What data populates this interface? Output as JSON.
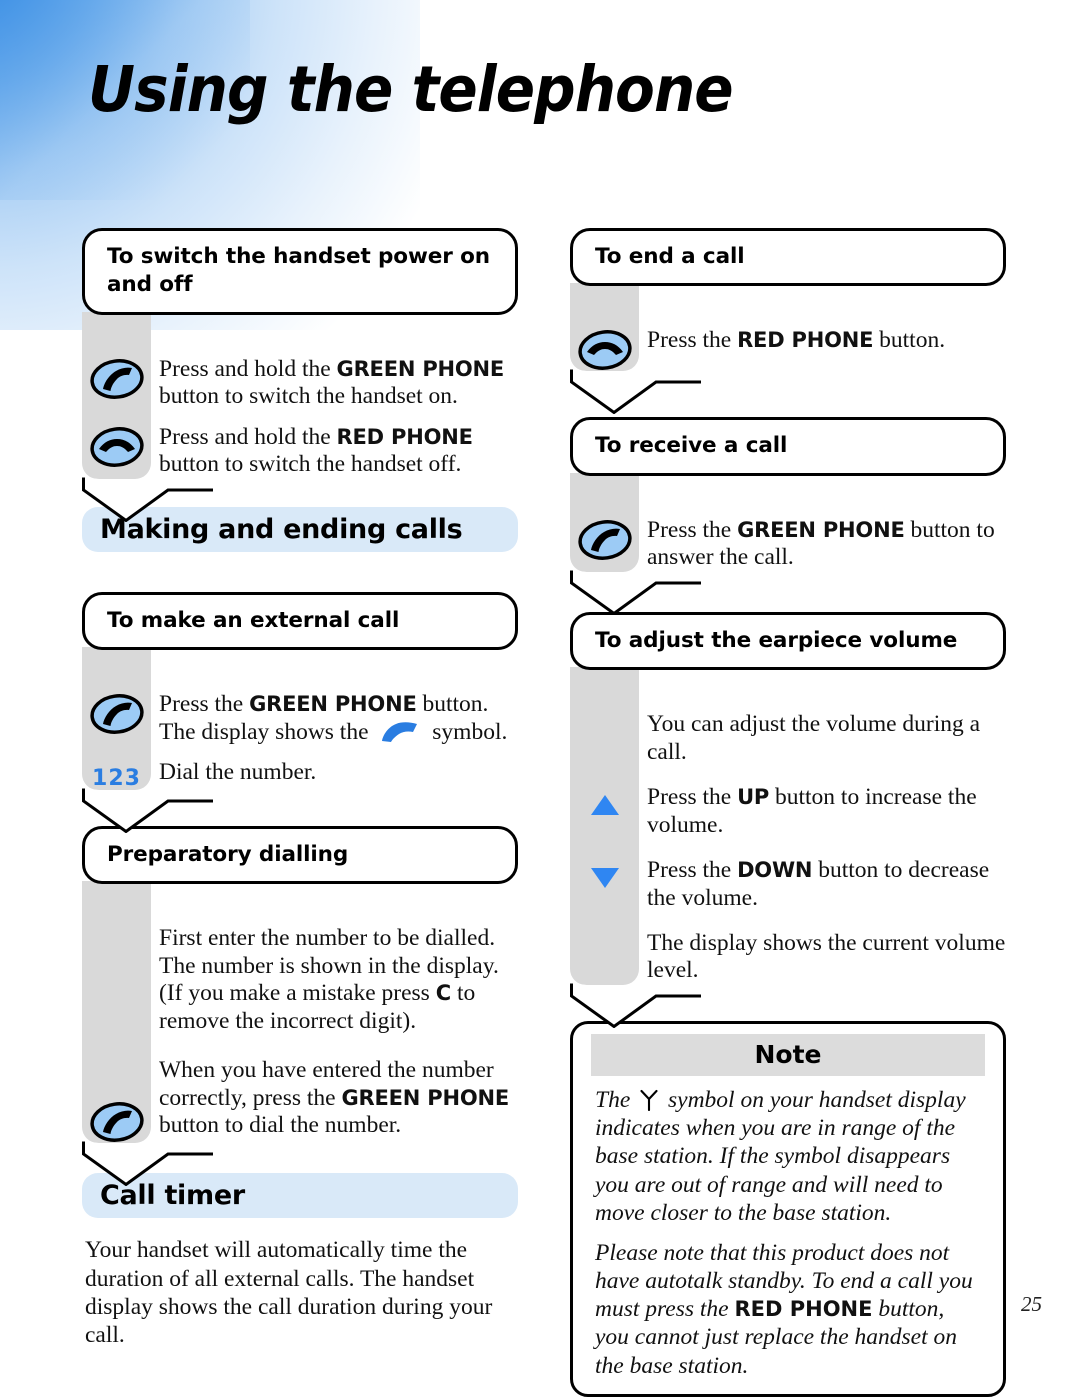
{
  "page": {
    "title": "Using the telephone",
    "number": "25"
  },
  "left_column": {
    "power_block": {
      "title": "To switch the handset power on and off",
      "rows": [
        {
          "icon": "green-phone-icon",
          "segments": [
            {
              "t": "Press and hold the ",
              "b": false
            },
            {
              "t": "GREEN PHONE",
              "b": true
            },
            {
              "t": " button to switch the handset on.",
              "b": false
            }
          ]
        },
        {
          "icon": "red-phone-icon",
          "segments": [
            {
              "t": "Press and hold the ",
              "b": false
            },
            {
              "t": "RED PHONE",
              "b": true
            },
            {
              "t": " button to switch the handset off.",
              "b": false
            }
          ]
        }
      ]
    },
    "making_ending_heading": "Making and ending calls",
    "external_call_block": {
      "title": "To make an external call",
      "rows": [
        {
          "icon": "green-phone-icon",
          "segments": [
            {
              "t": "Press the ",
              "b": false
            },
            {
              "t": "GREEN PHONE",
              "b": true
            },
            {
              "t": " button. The display shows the ",
              "b": false
            },
            {
              "t": "",
              "b": false,
              "glyph": "blue-handset-icon"
            },
            {
              "t": " symbol.",
              "b": false
            }
          ]
        },
        {
          "icon": "digits-123-icon",
          "icon_label": "123",
          "segments": [
            {
              "t": "Dial the number.",
              "b": false
            }
          ]
        }
      ]
    },
    "preparatory_block": {
      "title": "Preparatory dialling",
      "rows": [
        {
          "icon": "none",
          "segments": [
            {
              "t": "First enter the number to be dialled. The number is shown in the display. (If you make a mistake press ",
              "b": false
            },
            {
              "t": "C",
              "b": true
            },
            {
              "t": " to remove the incorrect digit).",
              "b": false
            }
          ]
        },
        {
          "icon": "green-phone-icon",
          "segments": [
            {
              "t": "When you have entered the number correctly, press the ",
              "b": false
            },
            {
              "t": "GREEN PHONE",
              "b": true
            },
            {
              "t": " button to dial the number.",
              "b": false
            }
          ]
        }
      ]
    },
    "call_timer_heading": "Call timer",
    "call_timer_text": "Your handset will automatically time the duration of all external calls. The handset display shows the call duration during your call."
  },
  "right_column": {
    "end_call_block": {
      "title": "To end a call",
      "rows": [
        {
          "icon": "red-phone-icon",
          "segments": [
            {
              "t": "Press the ",
              "b": false
            },
            {
              "t": "RED PHONE",
              "b": true
            },
            {
              "t": " button.",
              "b": false
            }
          ]
        }
      ]
    },
    "receive_call_block": {
      "title": "To receive a call",
      "rows": [
        {
          "icon": "green-phone-icon",
          "segments": [
            {
              "t": "Press the ",
              "b": false
            },
            {
              "t": "GREEN PHONE",
              "b": true
            },
            {
              "t": " button to answer the call.",
              "b": false
            }
          ]
        }
      ]
    },
    "volume_block": {
      "title": "To adjust the earpiece volume",
      "rows": [
        {
          "icon": "none",
          "segments": [
            {
              "t": "You can adjust the volume during a call.",
              "b": false
            }
          ]
        },
        {
          "icon": "up-triangle-icon",
          "segments": [
            {
              "t": "Press the ",
              "b": false
            },
            {
              "t": "UP",
              "b": true
            },
            {
              "t": " button to increase the volume.",
              "b": false
            }
          ]
        },
        {
          "icon": "down-triangle-icon",
          "segments": [
            {
              "t": "Press the ",
              "b": false
            },
            {
              "t": "DOWN",
              "b": true
            },
            {
              "t": " button to decrease the volume.",
              "b": false
            }
          ]
        },
        {
          "icon": "none",
          "segments": [
            {
              "t": "The display shows the current volume level.",
              "b": false
            }
          ]
        }
      ]
    },
    "note": {
      "heading": "Note",
      "paragraphs": [
        [
          {
            "t": "The ",
            "b": false
          },
          {
            "t": "",
            "b": false,
            "glyph": "antenna-icon"
          },
          {
            "t": " symbol on your handset display indicates when you are in range of the base station. If the symbol disappears you are out of range and will need to move closer to the base station.",
            "b": false
          }
        ],
        [
          {
            "t": "Please note that this product does not have autotalk standby. To end a call you must press the ",
            "b": false
          },
          {
            "t": "RED PHONE",
            "b": true
          },
          {
            "t": " button, you cannot just replace the handset on the base station.",
            "b": false
          }
        ]
      ]
    }
  },
  "colors": {
    "accent_blue": "#2a7de1",
    "icon_fill": "#9ccbf5",
    "rail_grey": "#d9d9d9",
    "section_blue": "#d9e9f8",
    "note_grey": "#dcdcdc"
  }
}
